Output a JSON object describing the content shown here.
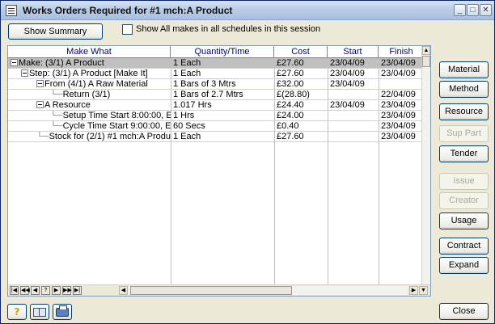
{
  "window": {
    "title": "Works Orders Required for #1 mch:A Product",
    "minimize_glyph": "_",
    "maximize_glyph": "□",
    "close_glyph": "✕"
  },
  "toolbar": {
    "show_summary_label": "Show Summary",
    "show_all_label": "Show All makes in all schedules in this session",
    "show_all_checked": false
  },
  "grid": {
    "columns": [
      "Make What",
      "Quantity/Time",
      "Cost",
      "Start",
      "Finish"
    ],
    "rows": [
      {
        "make_what": "Make: (3/1) A Product",
        "qty": "1 Each",
        "cost": "£27.60",
        "start": "23/04/09",
        "finish": "23/04/09",
        "indent": 0,
        "expander": true,
        "selected": true
      },
      {
        "make_what": "Step: (3/1) A Product [Make It]",
        "qty": "1 Each",
        "cost": "£27.60",
        "start": "23/04/09",
        "finish": "23/04/09",
        "indent": 1,
        "expander": true,
        "selected": false
      },
      {
        "make_what": "From (4/1) A Raw Material",
        "qty": "1 Bars of 3 Mtrs",
        "cost": "£32.00",
        "start": "23/04/09",
        "finish": "",
        "indent": 2,
        "expander": true,
        "selected": false
      },
      {
        "make_what": "Return (3/1)",
        "qty": "1 Bars of 2.7 Mtrs",
        "cost": "£(28.80)",
        "start": "",
        "finish": "22/04/09",
        "indent": 3,
        "expander": false,
        "selected": false
      },
      {
        "make_what": "A Resource",
        "qty": "1.017 Hrs",
        "cost": "£24.40",
        "start": "23/04/09",
        "finish": "23/04/09",
        "indent": 2,
        "expander": true,
        "selected": false
      },
      {
        "make_what": "Setup Time  Start  8:00:00, E",
        "qty": "1 Hrs",
        "cost": "£24.00",
        "start": "",
        "finish": "23/04/09",
        "indent": 3,
        "expander": false,
        "selected": false
      },
      {
        "make_what": "Cycle Time  Start  9:00:00, E",
        "qty": "60 Secs",
        "cost": "£0.40",
        "start": "",
        "finish": "23/04/09",
        "indent": 3,
        "expander": false,
        "selected": false
      },
      {
        "make_what": "Stock for (2/1) #1 mch:A Produ",
        "qty": "1 Each",
        "cost": "£27.60",
        "start": "",
        "finish": "23/04/09",
        "indent": 2,
        "expander": false,
        "selected": false
      }
    ]
  },
  "nav": {
    "first": "|◀",
    "prev_page": "◀◀",
    "prev": "◀",
    "help": "?",
    "next": "▶",
    "next_page": "▶▶",
    "last": "▶|"
  },
  "side_buttons": [
    {
      "label": "Material",
      "enabled": true
    },
    {
      "label": "Method",
      "enabled": true
    },
    {
      "label": "Resource",
      "enabled": true
    },
    {
      "label": "Sup Part",
      "enabled": false
    },
    {
      "label": "Tender",
      "enabled": true
    },
    {
      "label": "Issue",
      "enabled": false
    },
    {
      "label": "Creator",
      "enabled": false
    },
    {
      "label": "Usage",
      "enabled": true
    },
    {
      "label": "Contract",
      "enabled": true
    },
    {
      "label": "Expand",
      "enabled": true
    }
  ],
  "footer": {
    "help_icon": "help-icon",
    "layout_icon": "layout-icon",
    "print_icon": "print-icon",
    "close_label": "Close"
  }
}
